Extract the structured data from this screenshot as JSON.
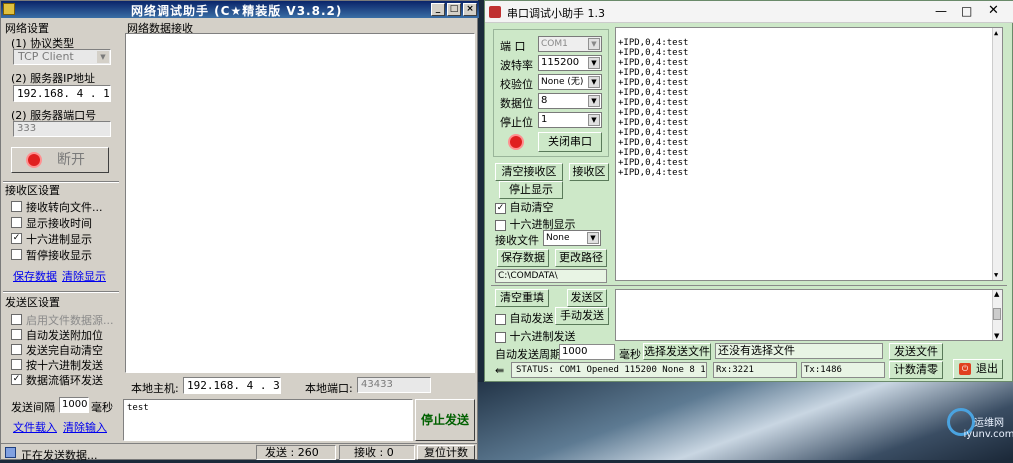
{
  "net": {
    "title": "网络调试助手 (C★精装版 V3.8.2)",
    "settings_group": "网络设置",
    "protocol_label": "(1) 协议类型",
    "protocol_value": "TCP Client",
    "server_ip_label": "(2) 服务器IP地址",
    "server_ip_value": "192.168. 4 . 1",
    "server_port_label": "(2) 服务器端口号",
    "server_port_value": "333",
    "disconnect_label": "断开",
    "receive_area_title": "网络数据接收",
    "recv_settings_group": "接收区设置",
    "recv_options": [
      "接收转向文件...",
      "显示接收时间",
      "十六进制显示",
      "暂停接收显示"
    ],
    "recv_checked": [
      false,
      false,
      true,
      false
    ],
    "save_data": "保存数据",
    "clear_display": "清除显示",
    "send_settings_group": "发送区设置",
    "send_options": [
      "启用文件数据源...",
      "自动发送附加位",
      "发送完自动清空",
      "按十六进制发送",
      "数据流循环发送"
    ],
    "send_checked": [
      false,
      false,
      false,
      false,
      true
    ],
    "send_interval_label": "发送间隔",
    "send_interval_value": "1000",
    "send_interval_unit": "毫秒",
    "file_load": "文件载入",
    "clear_input": "清除输入",
    "local_host_label": "本地主机:",
    "local_host_value": "192.168. 4 . 3",
    "local_port_label": "本地端口:",
    "local_port_value": "43433",
    "send_text": "test",
    "stop_send": "停止发送",
    "status_sending": "正在发送数据...",
    "status_sent_label": "发送 : 260",
    "status_recv_label": "接收 : 0",
    "reset_count": "复位计数"
  },
  "serial": {
    "title": "串口调试小助手 1.3",
    "port_label": "端  口",
    "port_value": "COM1",
    "baud_label": "波特率",
    "baud_value": "115200",
    "parity_label": "校验位",
    "parity_value": "None (无)",
    "databits_label": "数据位",
    "databits_value": "8",
    "stopbits_label": "停止位",
    "stopbits_value": "1",
    "close_port": "关闭串口",
    "clear_recv": "清空接收区",
    "recv_area_label": "接收区",
    "stop_display": "停止显示",
    "auto_clear": "自动清空",
    "hex_display": "十六进制显示",
    "recv_file_label": "接收文件",
    "recv_file_value": "None",
    "save_data": "保存数据",
    "change_path": "更改路径",
    "path_value": "C:\\COMDATA\\",
    "recv_lines": [
      "+IPD,0,4:test",
      "+IPD,0,4:test",
      "+IPD,0,4:test",
      "+IPD,0,4:test",
      "+IPD,0,4:test",
      "+IPD,0,4:test",
      "+IPD,0,4:test",
      "+IPD,0,4:test",
      "+IPD,0,4:test",
      "+IPD,0,4:test",
      "+IPD,0,4:test",
      "+IPD,0,4:test",
      "+IPD,0,4:test",
      "+IPD,0,4:test"
    ],
    "clear_resend": "清空重填",
    "send_area_label": "发送区",
    "auto_send": "自动发送",
    "manual_send": "手动发送",
    "hex_send": "十六进制发送",
    "auto_period_label": "自动发送周期",
    "auto_period_value": "1000",
    "auto_period_unit": "毫秒",
    "select_send_file": "选择发送文件",
    "no_file_selected": "还没有选择文件",
    "send_file": "发送文件",
    "status_text": "STATUS: COM1 Opened 115200 None  8 1",
    "rx_text": "Rx:3221",
    "tx_text": "Tx:1486",
    "count_clear": "计数清零",
    "exit": "退出"
  },
  "watermark": "运维网 iyunv.com"
}
